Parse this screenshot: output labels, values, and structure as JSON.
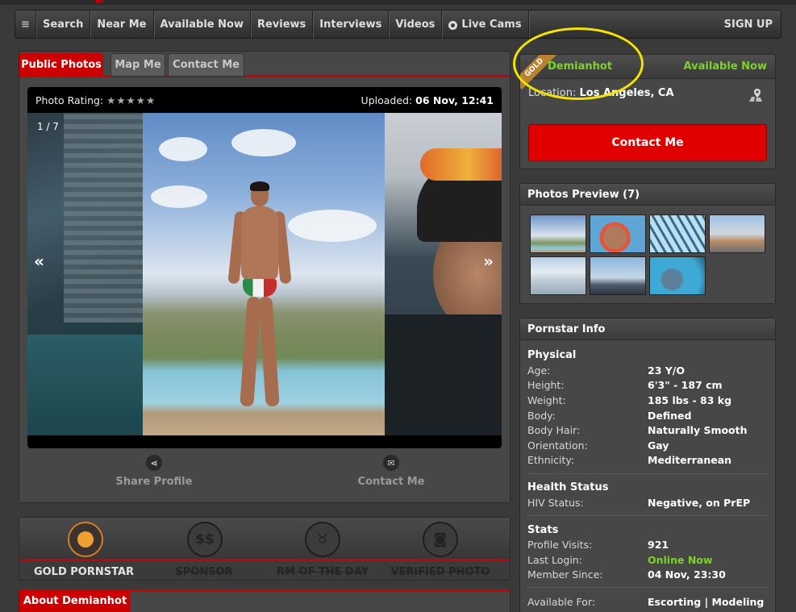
{
  "nav": {
    "menu_icon": "hamburger-icon",
    "items": [
      "Search",
      "Near Me",
      "Available Now",
      "Reviews",
      "Interviews",
      "Videos",
      "Live Cams"
    ],
    "signup": "SIGN UP"
  },
  "tabs": [
    "Public Photos",
    "Map Me",
    "Contact Me"
  ],
  "photo": {
    "rating_label": "Photo Rating:",
    "stars": "★★★★★",
    "uploaded_label": "Uploaded:",
    "uploaded_value": "06 Nov, 12:41",
    "counter": "1 / 7",
    "prev": "«",
    "next": "»"
  },
  "actions": {
    "share": "Share Profile",
    "contact": "Contact Me"
  },
  "badges": [
    {
      "label": "GOLD PORNSTAR",
      "icon": "gold-medal-icon",
      "active": true
    },
    {
      "label": "SPONSOR",
      "icon": "dollar-icon",
      "active": false
    },
    {
      "label": "RM OF THE DAY",
      "icon": "horns-icon",
      "active": false
    },
    {
      "label": "VERIFIED PHOTO",
      "icon": "camera-icon",
      "active": false
    }
  ],
  "about_tab": "About Demianhot",
  "profile": {
    "ribbon": "GOLD",
    "username": "Demianhot",
    "availability": "Available Now",
    "location_label": "Location:",
    "location_value": "Los Angeles, CA",
    "contact_button": "Contact Me"
  },
  "preview": {
    "title": "Photos Preview (7)"
  },
  "info": {
    "title": "Pornstar Info",
    "physical": {
      "title": "Physical",
      "rows": [
        {
          "k": "Age:",
          "v": "23 Y/O"
        },
        {
          "k": "Height:",
          "v": "6'3\" - 187 cm"
        },
        {
          "k": "Weight:",
          "v": "185 lbs - 83 kg"
        },
        {
          "k": "Body:",
          "v": "Defined"
        },
        {
          "k": "Body Hair:",
          "v": "Naturally Smooth"
        },
        {
          "k": "Orientation:",
          "v": "Gay"
        },
        {
          "k": "Ethnicity:",
          "v": "Mediterranean"
        }
      ]
    },
    "health": {
      "title": "Health Status",
      "rows": [
        {
          "k": "HIV Status:",
          "v": "Negative, on PrEP"
        }
      ]
    },
    "stats": {
      "title": "Stats",
      "rows": [
        {
          "k": "Profile Visits:",
          "v": "921"
        },
        {
          "k": "Last Login:",
          "v": "Online Now"
        },
        {
          "k": "Member Since:",
          "v": "04 Nov, 23:30"
        }
      ]
    },
    "available_for": {
      "k": "Available For:",
      "v": "Escorting | Modeling"
    }
  },
  "colors": {
    "accent_red": "#cc0000",
    "online_green": "#7ed22b",
    "highlight_yellow": "#f5e400"
  }
}
